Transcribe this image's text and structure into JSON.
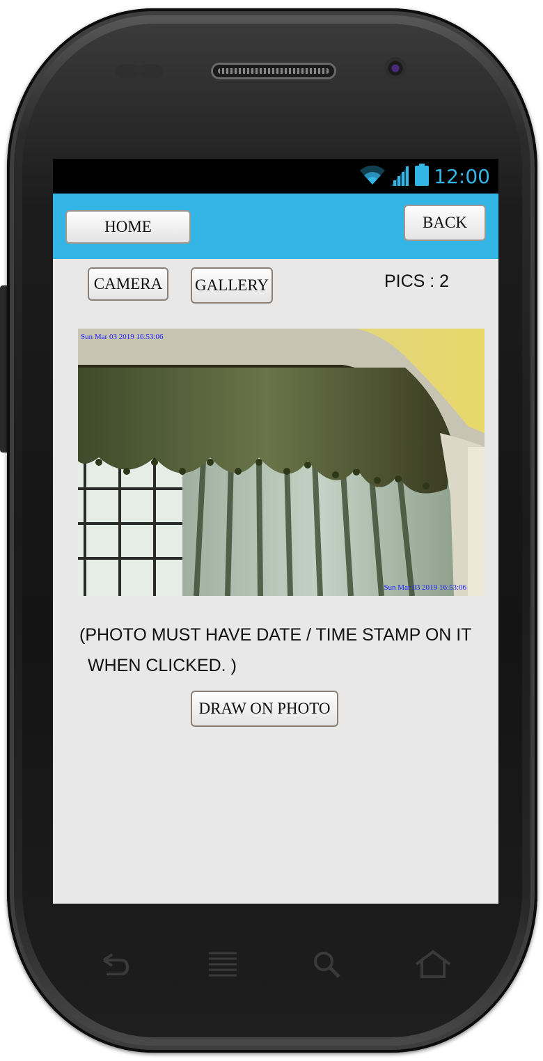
{
  "status_bar": {
    "time": "12:00",
    "icons": [
      "wifi-icon",
      "signal-icon",
      "battery-icon"
    ],
    "accent_color": "#33b5e5"
  },
  "header": {
    "color": "#33b5e5",
    "home_label": "HOME",
    "back_label": "BACK"
  },
  "toolbar": {
    "camera_label": "CAMERA",
    "gallery_label": "GALLERY",
    "pics_count": "PICS : 2"
  },
  "photo": {
    "timestamp_top": "Sun Mar 03 2019 16:53:06",
    "timestamp_bottom": "Sun Mar 03 2019 16:53:06",
    "timestamp_color": "#1a1aff"
  },
  "note": {
    "line1": "(PHOTO MUST HAVE DATE / TIME STAMP ON IT",
    "line2": "WHEN CLICKED. )"
  },
  "actions": {
    "draw_label": "DRAW ON PHOTO"
  },
  "hardware_keys": [
    "back-key-icon",
    "menu-key-icon",
    "search-key-icon",
    "home-key-icon"
  ]
}
